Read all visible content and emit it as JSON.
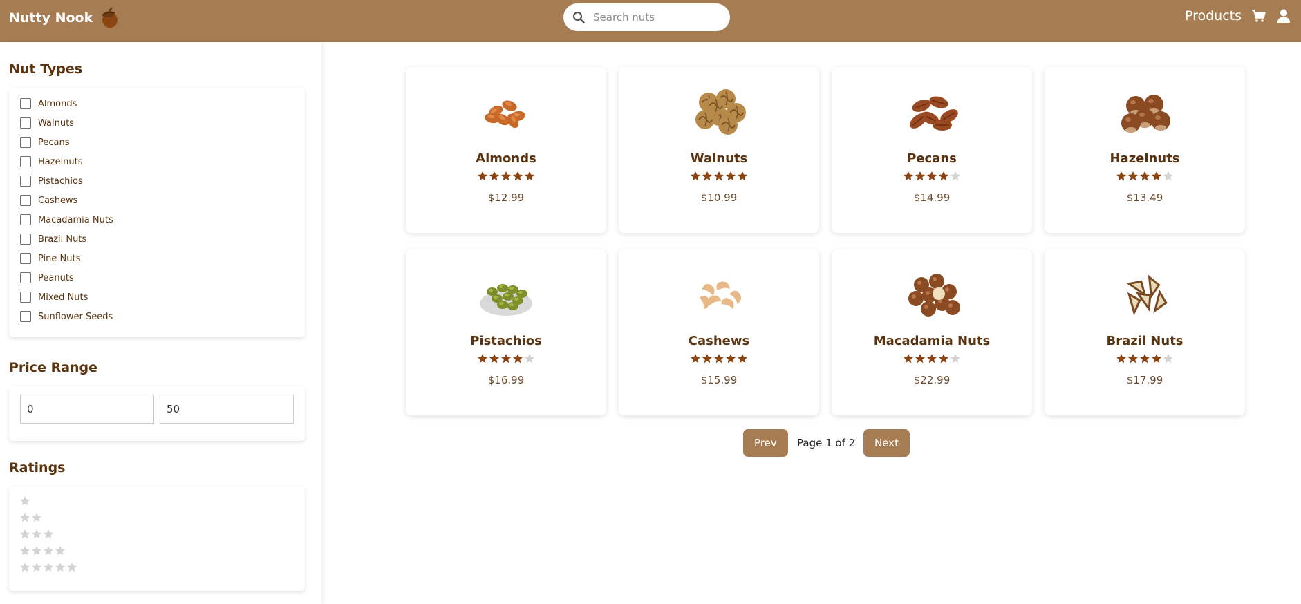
{
  "brand": {
    "name": "Nutty Nook",
    "icon": "acorn-icon"
  },
  "search": {
    "placeholder": "Search nuts"
  },
  "nav": {
    "products_label": "Products",
    "cart_icon": "cart-icon",
    "user_icon": "user-icon"
  },
  "colors": {
    "header": "#a67c52",
    "star_filled": "#8b4513",
    "star_empty": "#d3d3d3",
    "text": "#5a3410"
  },
  "sidebar": {
    "nut_types_title": "Nut Types",
    "nut_types": [
      "Almonds",
      "Walnuts",
      "Pecans",
      "Hazelnuts",
      "Pistachios",
      "Cashews",
      "Macadamia Nuts",
      "Brazil Nuts",
      "Pine Nuts",
      "Peanuts",
      "Mixed Nuts",
      "Sunflower Seeds"
    ],
    "price_range_title": "Price Range",
    "price_min": "0",
    "price_max": "50",
    "ratings_title": "Ratings",
    "rating_options": [
      1,
      2,
      3,
      4,
      5
    ]
  },
  "products": [
    {
      "name": "Almonds",
      "rating": 5,
      "price": "$12.99",
      "image": "almonds"
    },
    {
      "name": "Walnuts",
      "rating": 5,
      "price": "$10.99",
      "image": "walnuts"
    },
    {
      "name": "Pecans",
      "rating": 4,
      "price": "$14.99",
      "image": "pecans"
    },
    {
      "name": "Hazelnuts",
      "rating": 4,
      "price": "$13.49",
      "image": "hazelnuts"
    },
    {
      "name": "Pistachios",
      "rating": 4,
      "price": "$16.99",
      "image": "pistachios"
    },
    {
      "name": "Cashews",
      "rating": 5,
      "price": "$15.99",
      "image": "cashews"
    },
    {
      "name": "Macadamia Nuts",
      "rating": 4,
      "price": "$22.99",
      "image": "macadamia"
    },
    {
      "name": "Brazil Nuts",
      "rating": 4,
      "price": "$17.99",
      "image": "brazil"
    }
  ],
  "pagination": {
    "prev_label": "Prev",
    "page_text": "Page 1 of 2",
    "next_label": "Next"
  }
}
